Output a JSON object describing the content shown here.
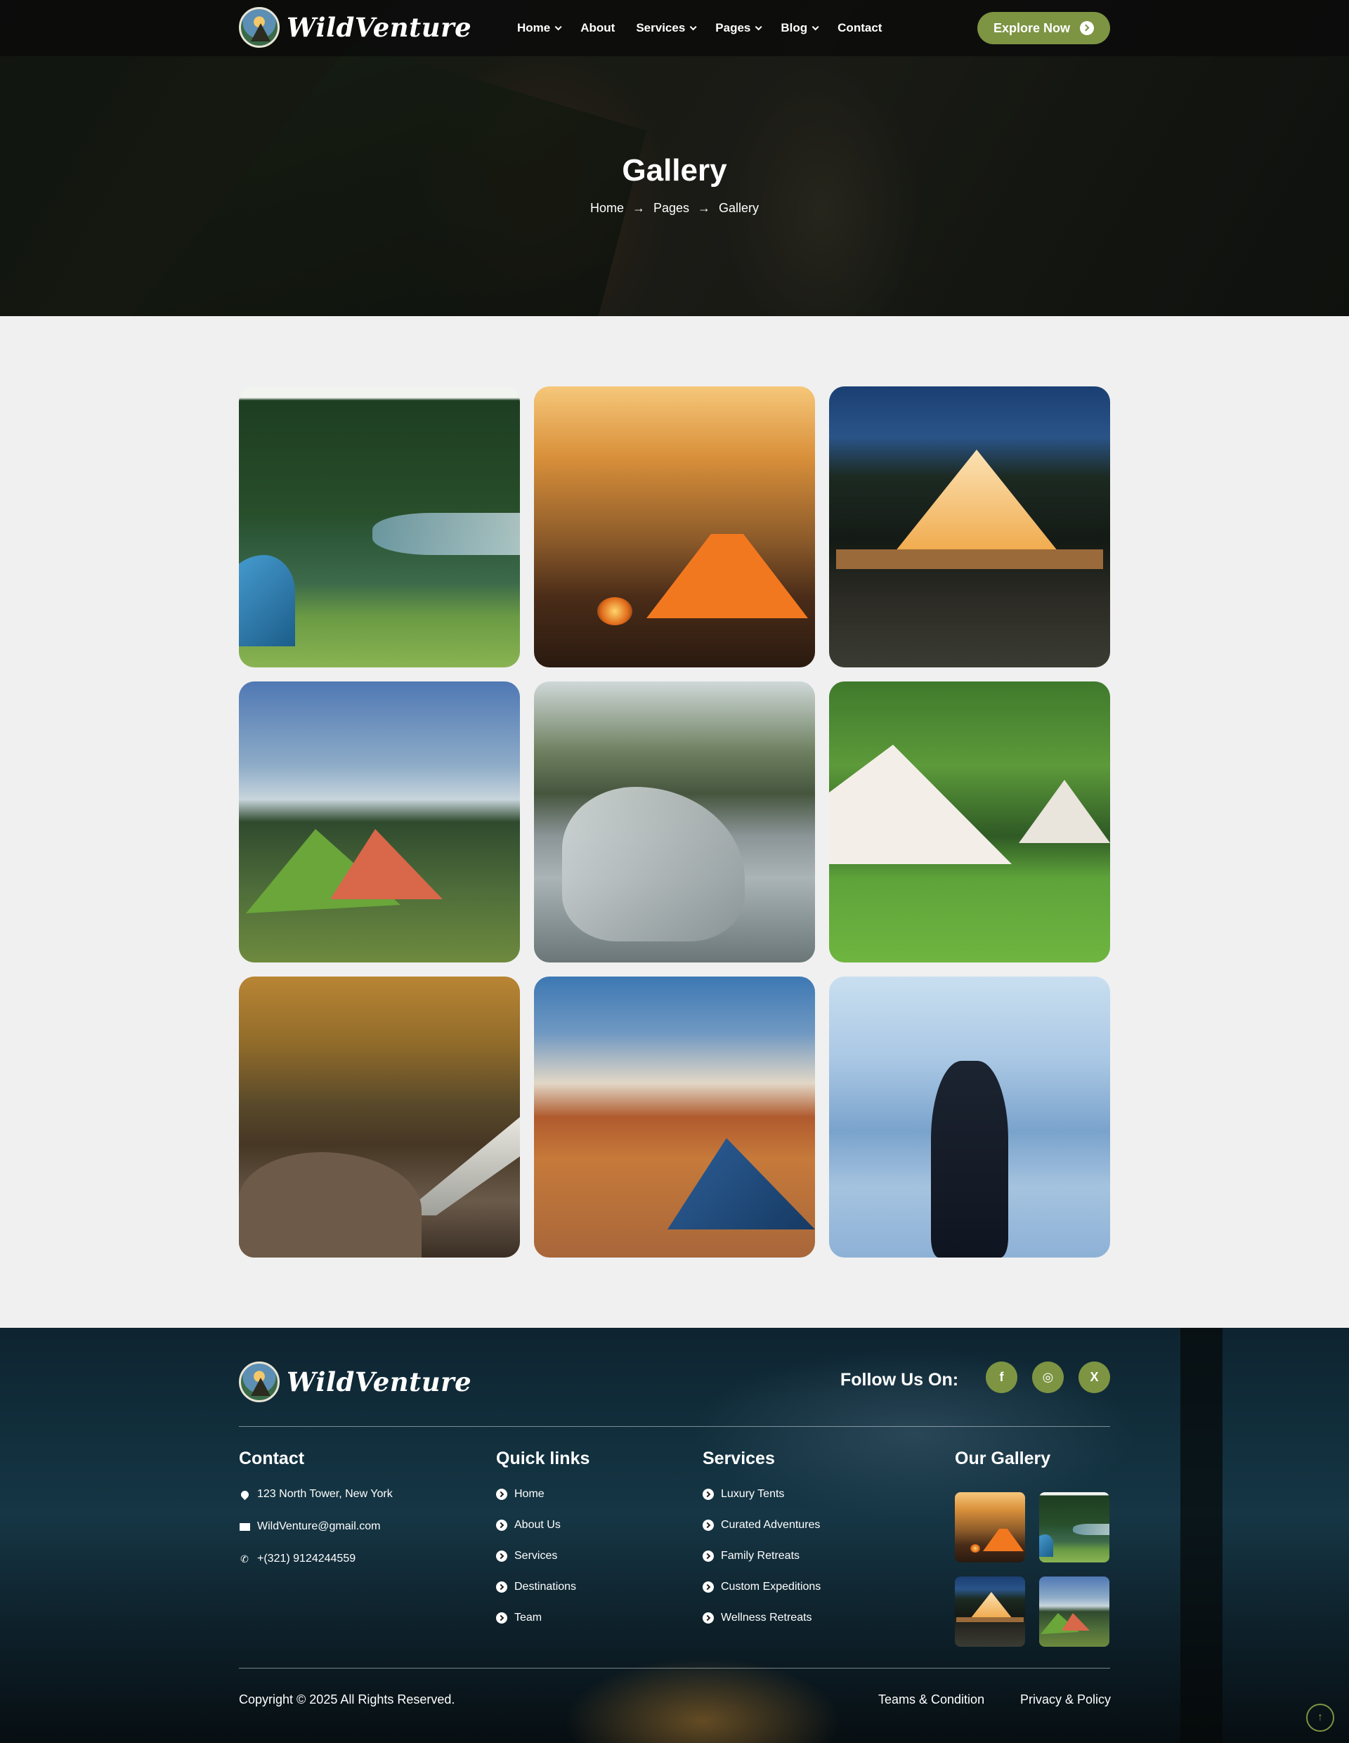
{
  "brand": {
    "name": "WildVenture"
  },
  "nav": {
    "items": [
      {
        "label": "Home",
        "has_dropdown": true
      },
      {
        "label": "About",
        "has_dropdown": false
      },
      {
        "label": "Services",
        "has_dropdown": true
      },
      {
        "label": "Pages",
        "has_dropdown": true
      },
      {
        "label": "Blog",
        "has_dropdown": true
      },
      {
        "label": "Contact",
        "has_dropdown": false
      }
    ],
    "cta_label": "Explore Now"
  },
  "hero": {
    "title": "Gallery",
    "breadcrumb": [
      "Home",
      "Pages",
      "Gallery"
    ]
  },
  "gallery": {
    "images": [
      {
        "icon": "lake-camping-image"
      },
      {
        "icon": "campfire-tent-image"
      },
      {
        "icon": "glamping-tent-image"
      },
      {
        "icon": "mountain-tents-image"
      },
      {
        "icon": "river-hikers-image"
      },
      {
        "icon": "bell-tents-image"
      },
      {
        "icon": "waterfall-image"
      },
      {
        "icon": "desert-tent-image"
      },
      {
        "icon": "backpacker-image"
      }
    ]
  },
  "footer": {
    "follow_label": "Follow Us On:",
    "social": [
      {
        "icon": "facebook-icon",
        "glyph": "f"
      },
      {
        "icon": "instagram-icon",
        "glyph": "◎"
      },
      {
        "icon": "x-icon",
        "glyph": "X"
      }
    ],
    "contact": {
      "title": "Contact",
      "address": "123 North Tower, New York",
      "email": "WildVenture@gmail.com",
      "phone": "+(321) 9124244559"
    },
    "quick_links": {
      "title": "Quick links",
      "items": [
        "Home",
        "About Us",
        "Services",
        "Destinations",
        "Team"
      ]
    },
    "services": {
      "title": "Services",
      "items": [
        "Luxury Tents",
        "Curated Adventures",
        "Family Retreats",
        "Custom Expeditions",
        "Wellness Retreats"
      ]
    },
    "gallery_title": "Our Gallery",
    "copyright": "Copyright © 2025 All Rights Reserved.",
    "legal": [
      "Teams & Condition",
      "Privacy & Policy"
    ]
  },
  "colors": {
    "accent": "#7d9443",
    "topbar": "#0a0a0a",
    "page_bg": "#f0f0f0"
  }
}
